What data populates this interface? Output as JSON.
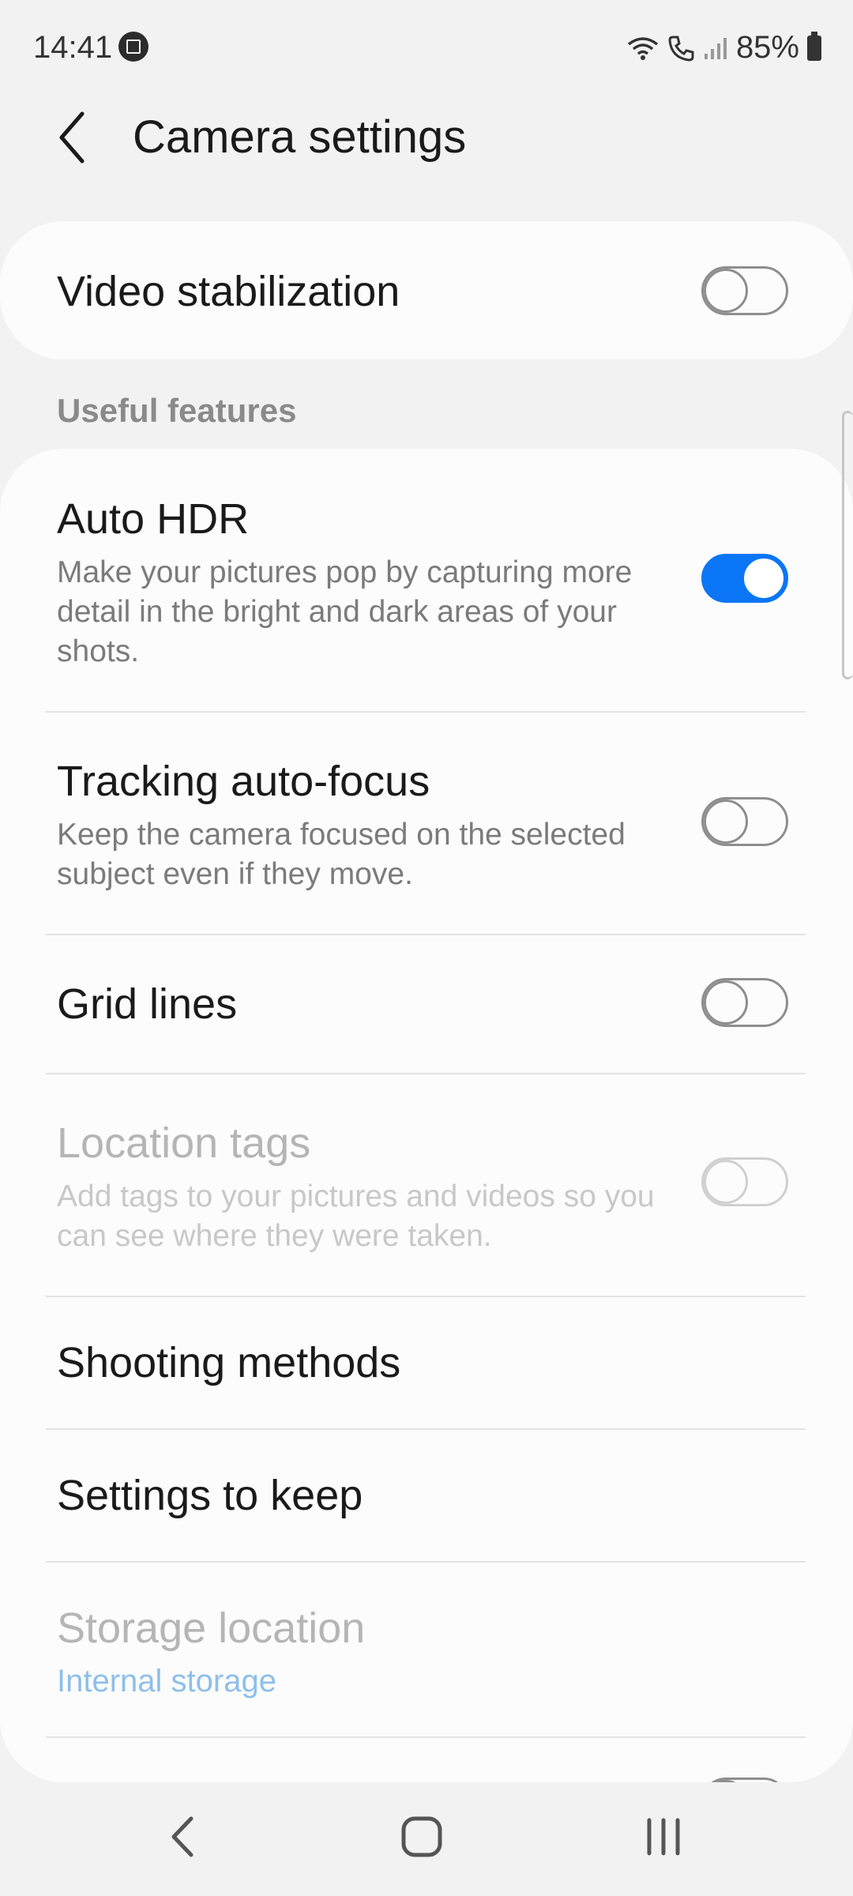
{
  "status_bar": {
    "time": "14:41",
    "battery_percent": "85%"
  },
  "header": {
    "title": "Camera settings"
  },
  "video_stabilization": {
    "label": "Video stabilization",
    "enabled": false
  },
  "section": {
    "header": "Useful features"
  },
  "settings": {
    "auto_hdr": {
      "title": "Auto HDR",
      "description": "Make your pictures pop by capturing more detail in the bright and dark areas of your shots.",
      "enabled": true
    },
    "tracking_af": {
      "title": "Tracking auto-focus",
      "description": "Keep the camera focused on the selected subject even if they move.",
      "enabled": false
    },
    "grid_lines": {
      "title": "Grid lines",
      "enabled": false
    },
    "location_tags": {
      "title": "Location tags",
      "description": "Add tags to your pictures and videos so you can see where they were taken.",
      "enabled": false,
      "disabled": true
    },
    "shooting_methods": {
      "title": "Shooting methods"
    },
    "settings_to_keep": {
      "title": "Settings to keep"
    },
    "storage_location": {
      "title": "Storage location",
      "value": "Internal storage",
      "disabled": true
    }
  },
  "colors": {
    "accent": "#0a76f5",
    "background": "#f2f2f2",
    "card": "#fcfcfc"
  }
}
